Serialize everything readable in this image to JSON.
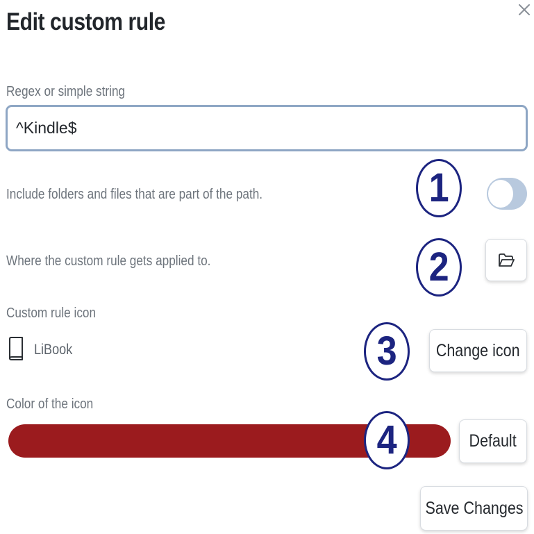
{
  "dialog": {
    "title": "Edit custom rule",
    "close_icon": "close-icon"
  },
  "regex": {
    "label": "Regex or simple string",
    "value": "^Kindle$"
  },
  "include_path": {
    "description": "Include folders and files that are part of the path.",
    "enabled": false
  },
  "applied_to": {
    "description": "Where the custom rule gets applied to.",
    "button_icon": "folder-open-icon"
  },
  "custom_icon": {
    "label": "Custom rule icon",
    "icon": "book-icon",
    "icon_name": "LiBook",
    "change_button": "Change icon"
  },
  "icon_color": {
    "label": "Color of the icon",
    "value": "#9b1b1e",
    "default_button": "Default"
  },
  "footer": {
    "save_button": "Save Changes"
  },
  "annotations": {
    "markers": [
      "1",
      "2",
      "3",
      "4"
    ],
    "color": "#1c2480"
  }
}
